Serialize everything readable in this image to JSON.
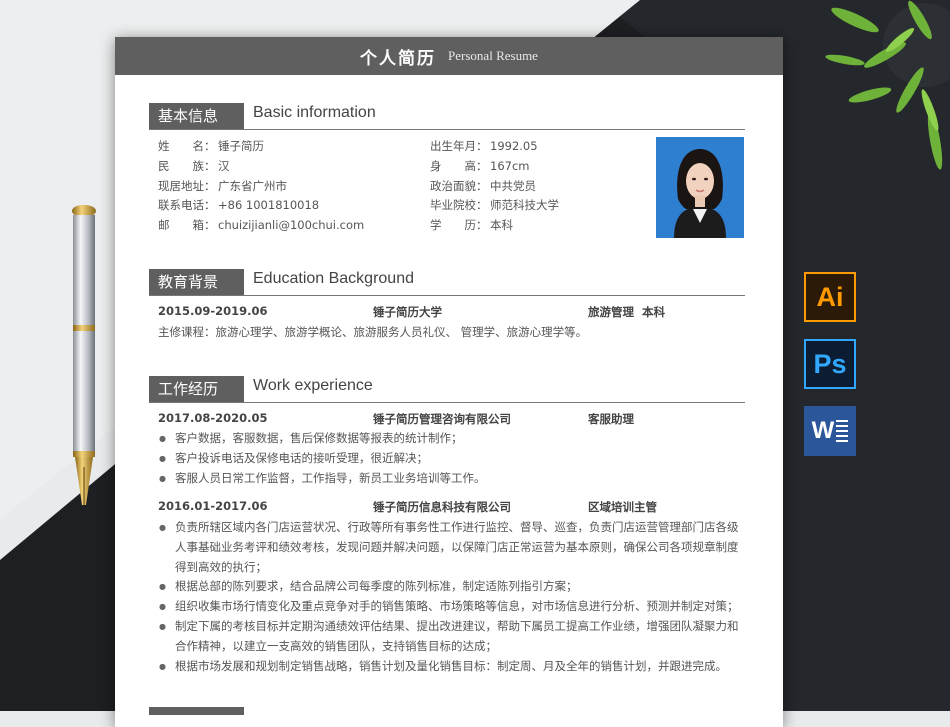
{
  "header": {
    "title_cn": "个人简历",
    "title_en": "Personal Resume"
  },
  "basic": {
    "tag": "基本信息",
    "title_en": "Basic information",
    "left": [
      {
        "label": "姓　　名：",
        "value": "锤子简历"
      },
      {
        "label": "民　　族：",
        "value": "汉"
      },
      {
        "label": "现居地址：",
        "value": "广东省广州市"
      },
      {
        "label": "联系电话：",
        "value": "+86 1001810018"
      },
      {
        "label": "邮　　箱：",
        "value": "chuizijianli@100chui.com"
      }
    ],
    "right": [
      {
        "label": "出生年月：",
        "value": "1992.05"
      },
      {
        "label": "身　　高：",
        "value": "167cm"
      },
      {
        "label": "政治面貌：",
        "value": "中共党员"
      },
      {
        "label": "毕业院校：",
        "value": "师范科技大学"
      },
      {
        "label": "学　　历：",
        "value": "本科"
      }
    ]
  },
  "education": {
    "tag": "教育背景",
    "title_en": "Education Background",
    "period": "2015.09-2019.06",
    "school": "锤子简历大学",
    "major": "旅游管理  本科",
    "courses": "主修课程：旅游心理学、旅游学概论、旅游服务人员礼仪、 管理学、旅游心理学等。"
  },
  "work": {
    "tag": "工作经历",
    "title_en": "Work experience",
    "jobs": [
      {
        "period": "2017.08-2020.05",
        "company": "锤子简历管理咨询有限公司",
        "position": "客服助理",
        "duties": [
          "客户数据，客服数据，售后保修数据等报表的统计制作；",
          "客户投诉电话及保修电话的接听受理，很近解决；",
          "客服人员日常工作监督，工作指导，新员工业务培训等工作。"
        ]
      },
      {
        "period": "2016.01-2017.06",
        "company": "锤子简历信息科技有限公司",
        "position": "区域培训主管",
        "duties": [
          "负责所辖区域内各门店运营状况、行政等所有事务性工作进行监控、督导、巡查，负责门店运营管理部门店各级人事基础业务考评和绩效考核，发现问题并解决问题，以保障门店正常运营为基本原则，确保公司各项规章制度得到高效的执行；",
          "根据总部的陈列要求，结合品牌公司每季度的陈列标准，制定适陈列指引方案；",
          "组织收集市场行情变化及重点竞争对手的销售策略、市场策略等信息，对市场信息进行分析、预测并制定对策；",
          "制定下属的考核目标并定期沟通绩效评估结果、提出改进建议，帮助下属员工提高工作业绩，增强团队凝聚力和合作精神，以建立一支高效的销售团队，支持销售目标的达成；",
          "根据市场发展和规划制定销售战略，销售计划及量化销售目标：制定周、月及全年的销售计划，并跟进完成。"
        ]
      }
    ]
  },
  "apps": [
    {
      "name": "Ai",
      "color": "#ff9a00",
      "bg": "#2b1a08"
    },
    {
      "name": "Ps",
      "color": "#31a8ff",
      "bg": "#0c1c33"
    },
    {
      "name": "W",
      "color": "#ffffff",
      "bg": "#2b579a"
    }
  ]
}
